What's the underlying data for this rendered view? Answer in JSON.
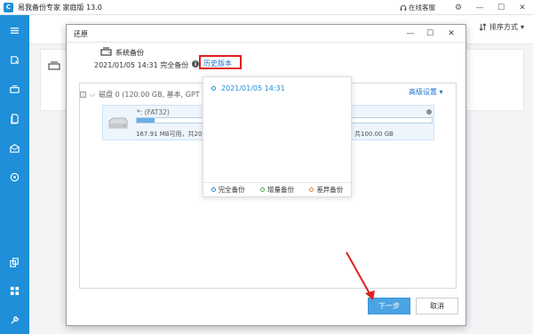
{
  "app": {
    "logo_letter": "C",
    "title": "易我备份专家 家庭版 13.0",
    "online_service": "在线客服"
  },
  "window_controls": {
    "settings": "⚙",
    "minimize": "—",
    "maximize": "☐",
    "close": "✕"
  },
  "sidebar": {
    "items": [
      {
        "icon": "menu-icon"
      },
      {
        "icon": "backup-disk-icon"
      },
      {
        "icon": "system-backup-icon"
      },
      {
        "icon": "file-backup-icon"
      },
      {
        "icon": "mail-backup-icon"
      },
      {
        "icon": "smart-backup-icon"
      },
      {
        "icon": "clone-icon"
      },
      {
        "icon": "apps-icon"
      },
      {
        "icon": "tools-icon"
      }
    ]
  },
  "toolbar": {
    "sort_label": "排序方式"
  },
  "dialog": {
    "title": "还原",
    "backup_name": "系统备份",
    "backup_date": "2021/01/05 14:31 完全备份",
    "history_link": "历史版本",
    "advanced_settings": "高级设置",
    "disk_header": "磁盘 0 (120.00 GB, 基本, GPT",
    "partition": {
      "label": "*: (FAT32)",
      "used_fraction": 0.06,
      "info": "167.91 MB可用，共200.",
      "info_right": "共100.00 GB"
    },
    "popup": {
      "version": "2021/01/05 14:31",
      "legend": [
        {
          "label": "完全备份",
          "color": "#1e8fd8"
        },
        {
          "label": "增量备份",
          "color": "#4caf50"
        },
        {
          "label": "差异备份",
          "color": "#f07c3a"
        }
      ]
    },
    "next_button": "下一步",
    "cancel_button": "取消"
  }
}
